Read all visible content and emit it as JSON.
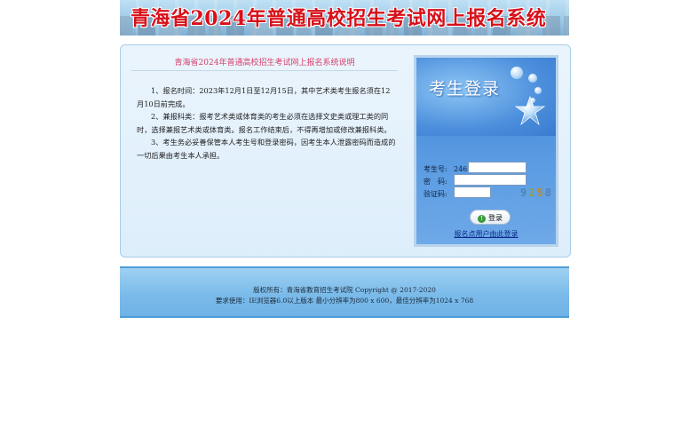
{
  "banner": {
    "title": "青海省2024年普通高校招生考试网上报名系统"
  },
  "info": {
    "title": "青海省2024年普通高校招生考试网上报名系统说明",
    "items": [
      "1、报名时间：2023年12月1日至12月15日，其中艺术类考生报名须在12月10日前完成。",
      "2、兼报科类：报考艺术类或体育类的考生必须在选择文史类或理工类的同时，选择兼报艺术类或体育类。报名工作结束后，不得再增加或修改兼报科类。",
      "3、考生务必妥善保管本人考生号和登录密码，因考生本人泄露密码而造成的一切后果由考生本人承担。"
    ]
  },
  "login": {
    "title": "考生登录",
    "exam_no_label": "考生号:",
    "exam_no_prefix": "2463",
    "password_label": "密　码:",
    "captcha_label": "验证码:",
    "captcha_digits": [
      "9",
      "2",
      "5",
      "8"
    ],
    "submit_label": "登录",
    "alt_link": "报名点用户由此登录",
    "colors": {
      "panel": "#4a8edc",
      "link": "#0b2a8a"
    },
    "icons": {
      "submit": "arrow-up-icon",
      "star": "star-icon"
    }
  },
  "footer": {
    "copyright": "版权所有：青海省教育招生考试院 Copyright @ 2017-2020",
    "requirements": "要求使用：IE浏览器6.0以上版本 最小分辨率为800 x 600，最佳分辨率为1024 x 768"
  }
}
